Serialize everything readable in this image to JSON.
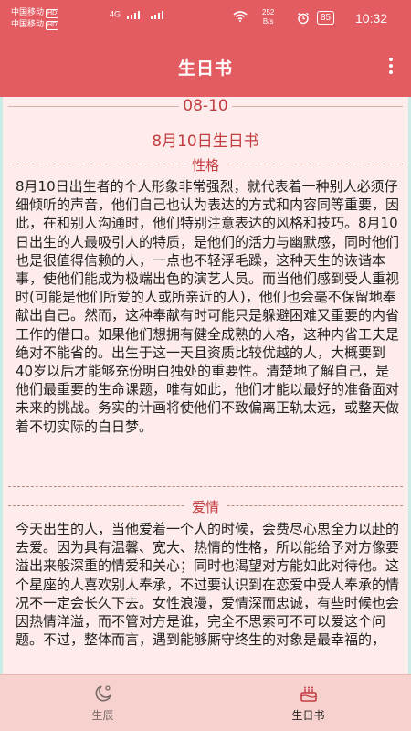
{
  "status_bar": {
    "carrier_1": "中国移动",
    "carrier_2": "中国移动",
    "hd_badge": "HD",
    "signal_label": "4G",
    "speed_value": "252",
    "speed_unit": "B/s",
    "battery": "85",
    "time": "10:32"
  },
  "app_bar": {
    "title": "生日书",
    "more_icon": "more-vertical-icon"
  },
  "content": {
    "date_code": "08-10",
    "heading": "8月10日生日书",
    "section_personality": "性格",
    "personality_text": "8月10日出生者的个人形象非常强烈，就代表着一种别人必须仔细倾听的声音，他们自己也认为表达的方式和内容同等重要，因此，在和别人沟通时，他们特别注意表达的风格和技巧。8月10日出生的人最吸引人的特质，是他们的活力与幽默感，同时他们也是很值得信赖的人，一点也不轻浮毛躁，这种天生的诙谐本事，使他们能成为极端出色的演艺人员。而当他们感到受人重视时(可能是他们所爱的人或所亲近的人)，他们也会毫不保留地奉献出自己。然而，这种奉献有时可能只是躲避困难又重要的内省工作的借口。如果他们想拥有健全成熟的人格，这种内省工夫是绝对不能省的。出生于这一天且资质比较优越的人，大概要到40岁以后才能够充份明白独处的重要性。清楚地了解自己，是他们最重要的生命课题，唯有如此，他们才能以最好的准备面对未来的挑战。务实的计画将使他们不致偏离正轨太远，或整天做着不切实际的白日梦。",
    "section_love": "爱情",
    "love_text": "今天出生的人，当他爱着一个人的时候，会费尽心思全力以赴的去爱。因为具有温馨、宽大、热情的性格，所以能给予对方像要溢出来般深重的情爱和关心；同时也渴望对方能如此对待他。这个星座的人喜欢别人奉承，不过要认识到在恋爱中受人奉承的情况不一定会长久下去。女性浪漫，爱情深而忠诚，有些时候也会因热情洋溢，而不管对方是谁，完全不思索可不可以爱这个问题。不过，整体而言，遇到能够厮守终生的对象是最幸福的，"
  },
  "bottom_nav": {
    "left_label": "生辰",
    "right_label": "生日书",
    "left_icon": "moon-sun-icon",
    "right_icon": "birthday-cake-icon"
  },
  "colors": {
    "primary": "#e25c62",
    "accent_text": "#c23d41",
    "background": "#fdeceb"
  }
}
